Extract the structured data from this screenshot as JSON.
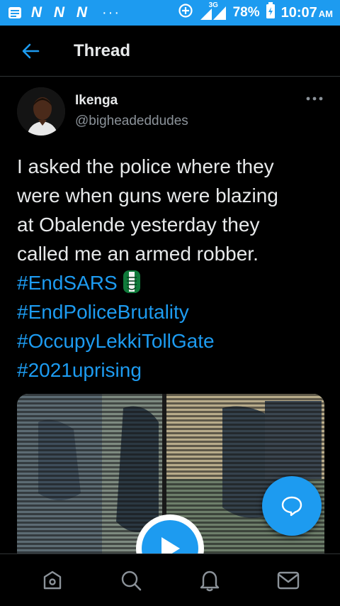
{
  "status_bar": {
    "notifications": [
      "N",
      "N",
      "N"
    ],
    "more": "···",
    "network": "3G",
    "battery": "78%",
    "time": "10:07",
    "ampm": "AM"
  },
  "header": {
    "title": "Thread"
  },
  "tweet": {
    "author_name": "Ikenga",
    "author_handle": "@bigheadeddudes",
    "text_lines": [
      "I asked the police where they",
      "were when guns were blazing",
      "at Obalende yesterday they",
      "called me an armed robber."
    ],
    "hashtags": [
      "#EndSARS",
      "#EndPoliceBrutality",
      "#OccupyLekkiTollGate",
      "#2021uprising"
    ],
    "emoji_after_first_hashtag": "raised-fist-nigeria-flag"
  },
  "colors": {
    "accent": "#1d9bf0",
    "background": "#000000",
    "text_primary": "#e7e9ea",
    "text_secondary": "#8b9299",
    "divider": "#2f3336"
  },
  "icons": {
    "back": "arrow-left-icon",
    "more": "more-horizontal-icon",
    "play": "play-icon",
    "compose": "chat-bubble-icon",
    "nav": [
      "home-icon",
      "search-icon",
      "notifications-bell-icon",
      "messages-envelope-icon"
    ]
  }
}
